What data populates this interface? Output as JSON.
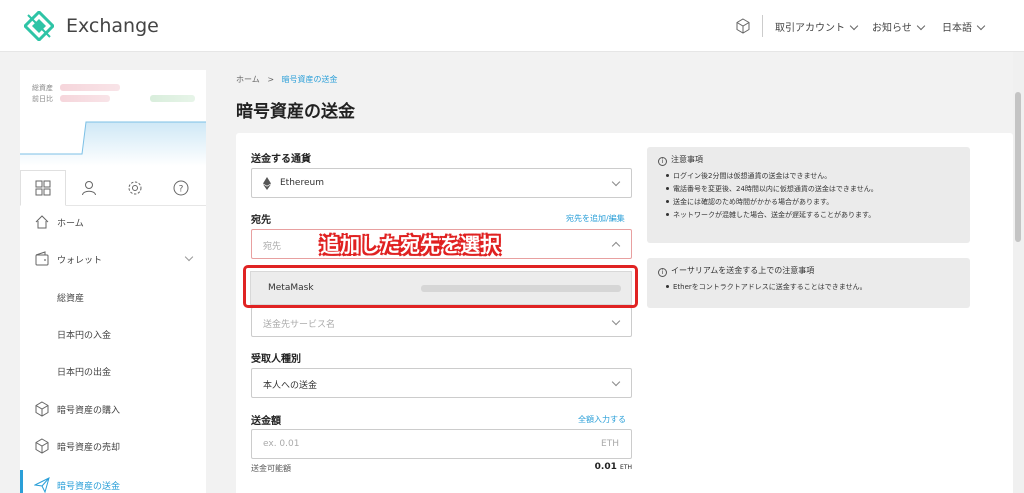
{
  "header": {
    "brand": "Exchange",
    "menu": [
      {
        "label": "取引アカウント"
      },
      {
        "label": "お知らせ"
      },
      {
        "label": "日本語"
      }
    ]
  },
  "sidebar": {
    "balance_label_1": "総資産",
    "balance_label_2": "前日比",
    "items": [
      {
        "label": "ホーム",
        "icon": "home-icon"
      },
      {
        "label": "ウォレット",
        "icon": "wallet-icon"
      },
      {
        "label": "総資産"
      },
      {
        "label": "日本円の入金"
      },
      {
        "label": "日本円の出金"
      },
      {
        "label": "暗号資産の購入",
        "icon": "cube-icon"
      },
      {
        "label": "暗号資産の売却",
        "icon": "cube-icon"
      },
      {
        "label": "暗号資産の送金",
        "icon": "send-icon"
      }
    ]
  },
  "breadcrumb": {
    "home": "ホーム",
    "sep": ">",
    "current": "暗号資産の送金"
  },
  "page_title": "暗号資産の送金",
  "form": {
    "currency_label": "送金する通貨",
    "currency_value": "Ethereum",
    "dest_label": "宛先",
    "dest_link": "宛先を追加/編集",
    "dest_placeholder": "宛先",
    "dropdown_option": "MetaMask",
    "service_placeholder": "送金先サービス名",
    "recipient_label": "受取人種別",
    "recipient_value": "本人への送金",
    "amount_label": "送金額",
    "amount_link": "全額入力する",
    "amount_placeholder": "ex. 0.01",
    "amount_unit": "ETH",
    "available_label": "送金可能額",
    "available_value": "0.01",
    "available_unit": "ETH"
  },
  "annotation": "追加した宛先を選択",
  "notices": [
    {
      "title": "注意事項",
      "items": [
        "ログイン後2分間は仮想通貨の送金はできません。",
        "電話番号を変更後、24時間以内に仮想通貨の送金はできません。",
        "送金には確認のため時間がかかる場合があります。",
        "ネットワークが混雑した場合、送金が遅延することがあります。"
      ]
    },
    {
      "title": "イーサリアムを送金する上での注意事項",
      "items": [
        "Etherをコントラクトアドレスに送金することはできません。"
      ]
    }
  ],
  "colors": {
    "accent": "#2a9fd8",
    "logo": "#2ec4a6",
    "highlight": "#e02323"
  }
}
